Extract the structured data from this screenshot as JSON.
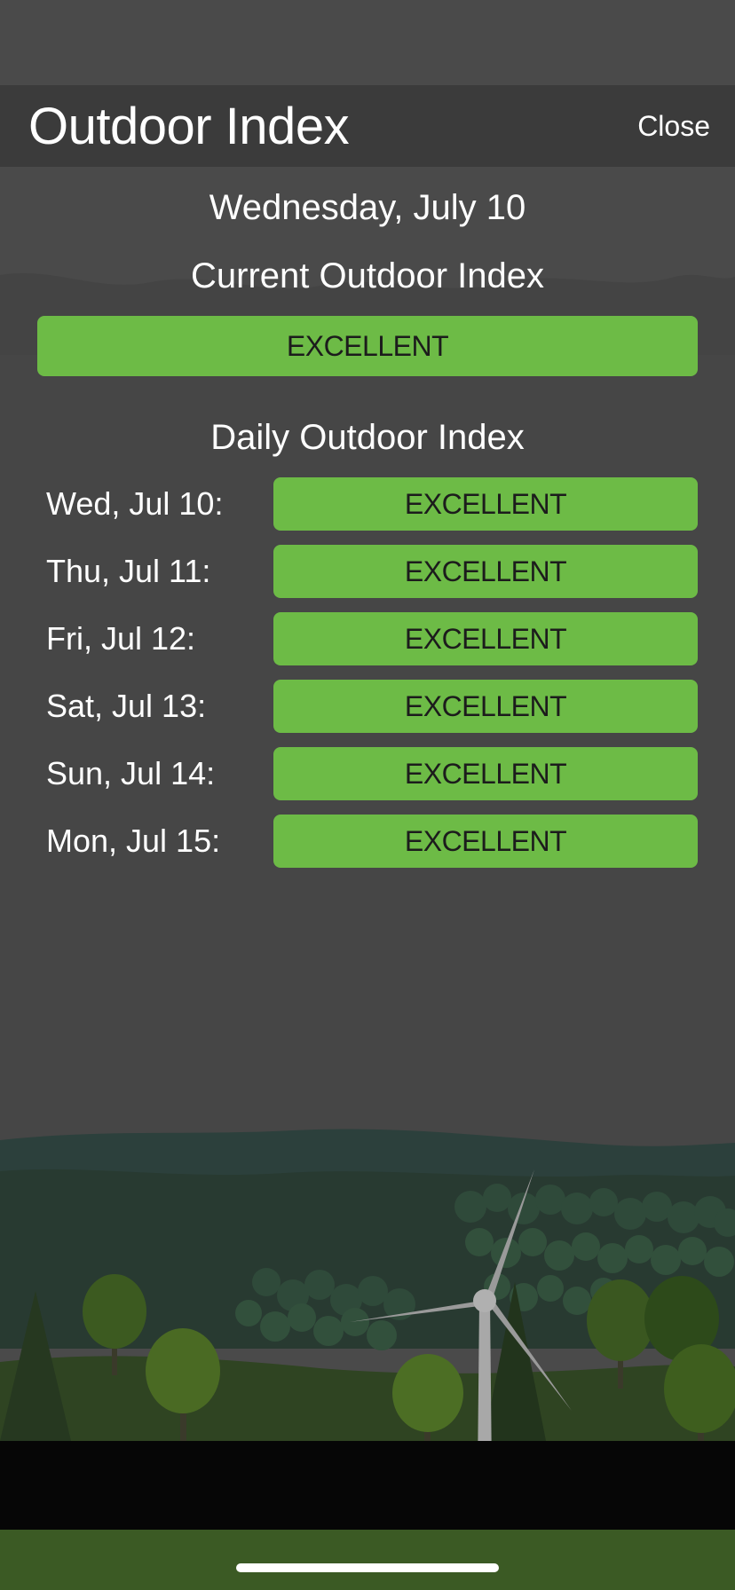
{
  "header": {
    "title": "Outdoor Index",
    "close_label": "Close"
  },
  "date": "Wednesday, July 10",
  "current": {
    "heading": "Current Outdoor Index",
    "value": "EXCELLENT",
    "color": "#6dbb46"
  },
  "daily": {
    "heading": "Daily Outdoor Index",
    "rows": [
      {
        "day": "Wed, Jul 10:",
        "value": "EXCELLENT"
      },
      {
        "day": "Thu, Jul 11:",
        "value": "EXCELLENT"
      },
      {
        "day": "Fri, Jul 12:",
        "value": "EXCELLENT"
      },
      {
        "day": "Sat, Jul 13:",
        "value": "EXCELLENT"
      },
      {
        "day": "Sun, Jul 14:",
        "value": "EXCELLENT"
      },
      {
        "day": "Mon, Jul 15:",
        "value": "EXCELLENT"
      }
    ]
  }
}
